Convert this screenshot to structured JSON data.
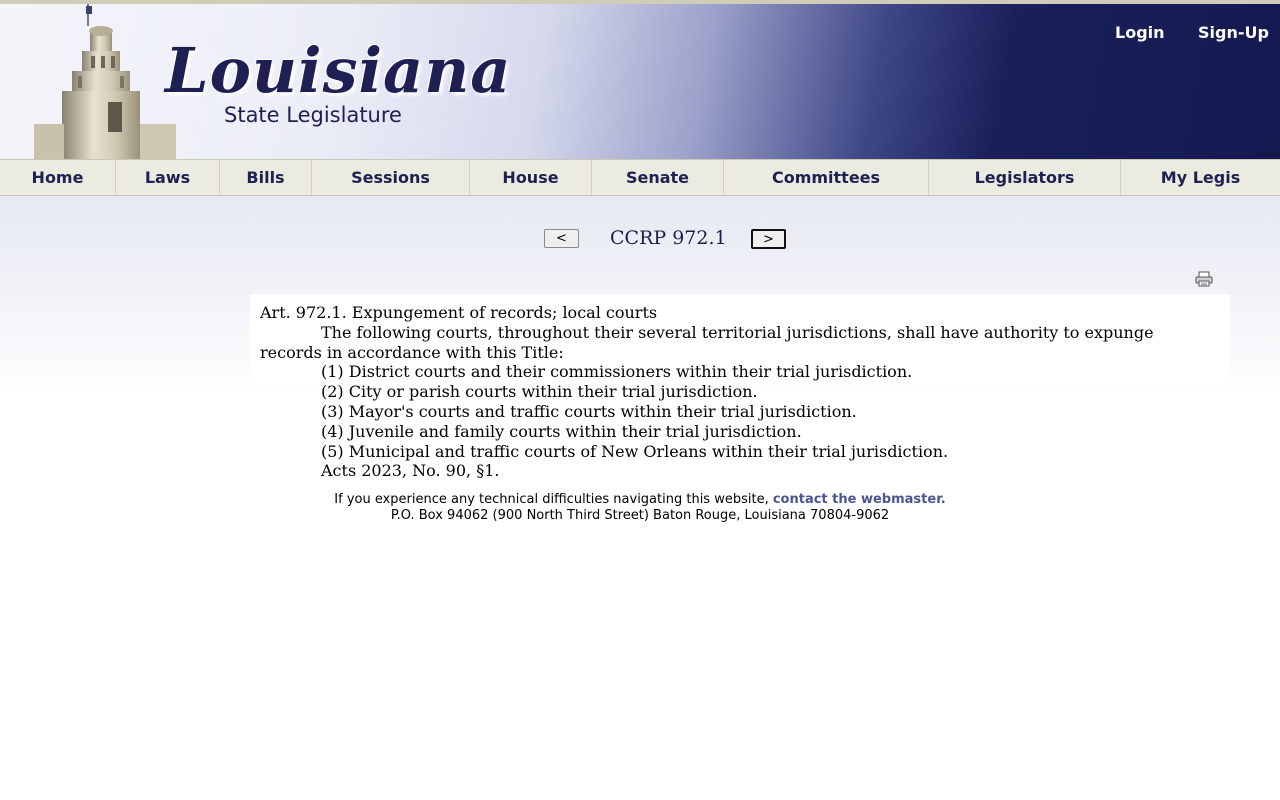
{
  "header": {
    "logo_title": "Louisiana",
    "logo_subtitle": "State Legislature",
    "login_label": "Login",
    "signup_label": "Sign-Up"
  },
  "nav": {
    "items": [
      {
        "label": "Home"
      },
      {
        "label": "Laws"
      },
      {
        "label": "Bills"
      },
      {
        "label": "Sessions"
      },
      {
        "label": "House"
      },
      {
        "label": "Senate"
      },
      {
        "label": "Committees"
      },
      {
        "label": "Legislators"
      },
      {
        "label": "My Legis"
      }
    ]
  },
  "doc_nav": {
    "prev_label": "<",
    "title": "CCRP 972.1",
    "next_label": ">"
  },
  "icons": {
    "print": "printer-icon"
  },
  "article": {
    "heading": "Art. 972.1. Expungement of records; local courts",
    "intro": "The following courts, throughout their several territorial jurisdictions, shall have authority to expunge records in accordance with this Title:",
    "items": [
      "(1) District courts and their commissioners within their trial jurisdiction.",
      "(2) City or parish courts within their trial jurisdiction.",
      "(3) Mayor's courts and traffic courts within their trial jurisdiction.",
      "(4) Juvenile and family courts within their trial jurisdiction.",
      "(5) Municipal and traffic courts of New Orleans within their trial jurisdiction."
    ],
    "history": "Acts 2023, No. 90, §1."
  },
  "footer": {
    "notice": "If you experience any technical difficulties navigating this website, ",
    "webmaster_link": "contact the webmaster.",
    "address": "P.O. Box 94062 (900 North Third Street) Baton Rouge, Louisiana 70804-9062"
  },
  "colors": {
    "header_dark": "#141a50",
    "nav_bg": "#ecebe0",
    "nav_text": "#1c2354",
    "link": "#4a5592"
  }
}
